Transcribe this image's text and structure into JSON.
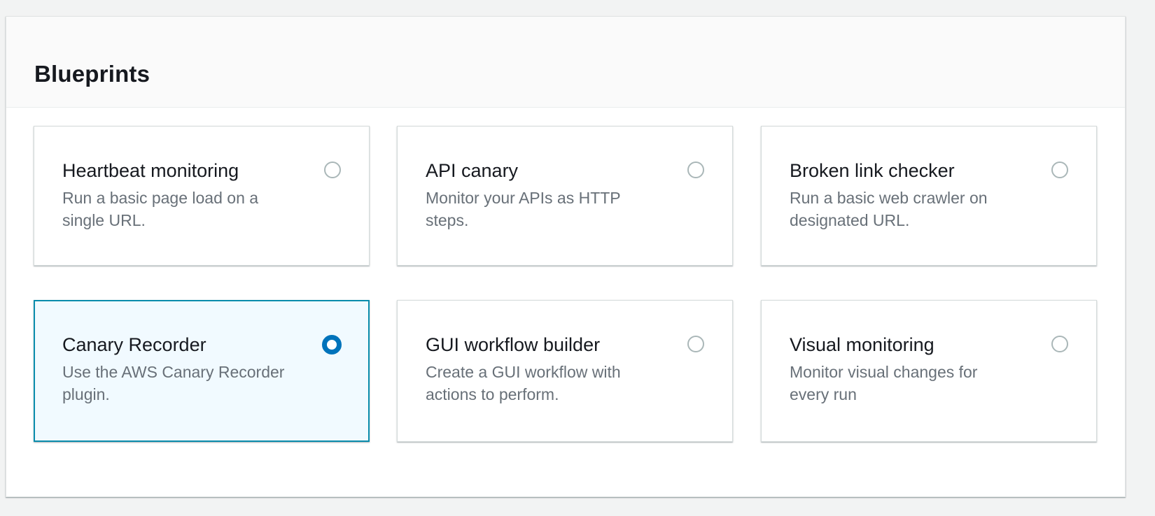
{
  "section": {
    "title": "Blueprints"
  },
  "cards": [
    {
      "title": "Heartbeat monitoring",
      "description": "Run a basic page load on a single URL.",
      "selected": false
    },
    {
      "title": "API canary",
      "description": "Monitor your APIs as HTTP steps.",
      "selected": false
    },
    {
      "title": "Broken link checker",
      "description": "Run a basic web crawler on designated URL.",
      "selected": false
    },
    {
      "title": "Canary Recorder",
      "description": "Use the AWS Canary Recorder plugin.",
      "selected": true
    },
    {
      "title": "GUI workflow builder",
      "description": "Create a GUI workflow with actions to perform.",
      "selected": false
    },
    {
      "title": "Visual monitoring",
      "description": "Monitor visual changes for every run",
      "selected": false
    }
  ],
  "colors": {
    "selected_border": "#0a8cac",
    "selected_background": "#f1faff",
    "radio_checked": "#0073bb",
    "radio_unchecked": "#aab7b8"
  }
}
